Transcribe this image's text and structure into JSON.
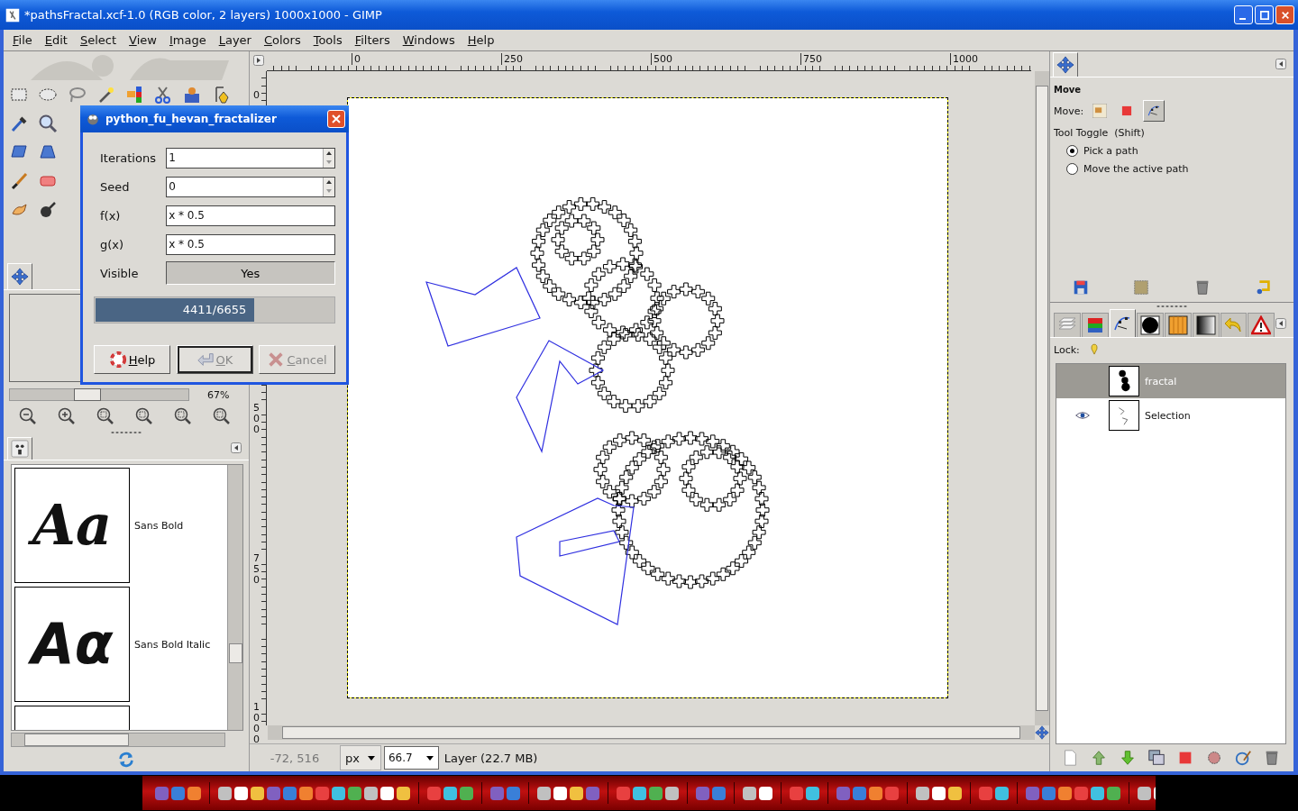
{
  "window": {
    "title": "*pathsFractal.xcf-1.0 (RGB color, 2 layers) 1000x1000 - GIMP"
  },
  "menu": [
    "File",
    "Edit",
    "Select",
    "View",
    "Image",
    "Layer",
    "Colors",
    "Tools",
    "Filters",
    "Windows",
    "Help"
  ],
  "toolbox": {
    "zoom_reading": "67%",
    "zoom_slider": {
      "level": 0.42
    }
  },
  "fonts": [
    {
      "preview": "Aa",
      "name": "Sans Bold",
      "kind": "script"
    },
    {
      "preview": "Aα",
      "name": "Sans Bold Italic",
      "kind": "bold-italic"
    }
  ],
  "rulers": {
    "horizontal": [
      "0",
      "250",
      "500",
      "750",
      "1000"
    ],
    "vertical": [
      "0",
      "500",
      "750",
      "1000"
    ]
  },
  "status_bar": {
    "coordinates": "-72, 516",
    "unit": "px",
    "zoom": "66.7",
    "message": "Layer (22.7 MB)"
  },
  "dialog": {
    "title": "python_fu_hevan_fractalizer",
    "fields": [
      {
        "label": "Iterations",
        "kind": "spin",
        "value": "1"
      },
      {
        "label": "Seed",
        "kind": "spin",
        "value": "0"
      },
      {
        "label": "f(x)",
        "kind": "entry",
        "value": "x * 0.5"
      },
      {
        "label": "g(x)",
        "kind": "entry",
        "value": "x * 0.5"
      },
      {
        "label": "Visible",
        "kind": "toggle",
        "value": "Yes",
        "pressed": true
      }
    ],
    "progress": {
      "level": 0.663,
      "text": "4411/6655"
    },
    "buttons": [
      {
        "label": "Help",
        "disabled": false,
        "focused": false
      },
      {
        "label": "OK",
        "disabled": true,
        "focused": true
      },
      {
        "label": "Cancel",
        "disabled": true,
        "focused": false
      }
    ]
  },
  "tool_options": {
    "title": "Move",
    "move_label": "Move:",
    "modes": [
      {
        "selected": false
      },
      {
        "selected": false
      },
      {
        "selected": true
      }
    ],
    "toggle_label": "Tool Toggle  (Shift)",
    "radios": [
      {
        "label": "Pick a path",
        "selected": true
      },
      {
        "label": "Move the active path",
        "selected": false
      }
    ]
  },
  "layers": {
    "tabs": [
      {
        "selected": false
      },
      {
        "selected": false
      },
      {
        "selected": true
      },
      {
        "selected": false
      },
      {
        "selected": false
      },
      {
        "selected": false
      },
      {
        "selected": false
      },
      {
        "selected": false
      }
    ],
    "lock_label": "Lock:",
    "rows": [
      {
        "name": "fractal",
        "visible": false,
        "selected": true
      },
      {
        "name": "Selection",
        "visible": true,
        "selected": false
      }
    ]
  }
}
